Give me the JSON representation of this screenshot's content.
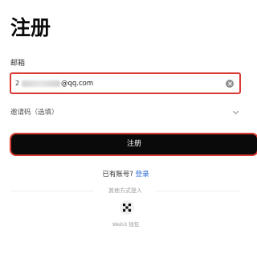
{
  "page": {
    "title": "注册"
  },
  "email": {
    "label": "邮箱",
    "value_prefix": "2",
    "value_domain": "@qq.com",
    "clear_icon": "clear-circle-icon"
  },
  "invite": {
    "label": "邀请码（选填）",
    "toggle_icon": "chevron-down-icon"
  },
  "register": {
    "button_label": "注册"
  },
  "login": {
    "question": "已有账号?",
    "link": "登录"
  },
  "other_methods": {
    "divider_text": "其他方式登入",
    "web3": {
      "icon": "web3-wallet-icon",
      "label": "Web3 钱包"
    }
  },
  "colors": {
    "highlight_border": "#d93a33",
    "button_bg": "#0a0a0a",
    "link": "#2b6ad6"
  }
}
